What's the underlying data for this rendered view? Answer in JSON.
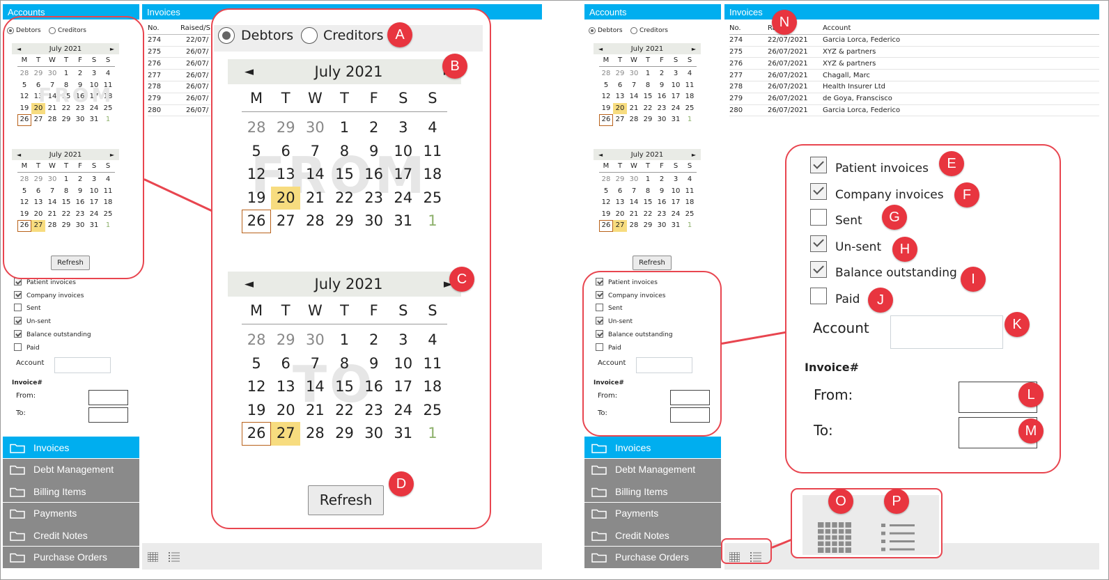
{
  "accounts_title": "Accounts",
  "invoices_title": "Invoices",
  "radio": {
    "debtors": "Debtors",
    "creditors": "Creditors"
  },
  "calendar": {
    "month": "July 2021",
    "prev": "◄",
    "next": "►",
    "dow": [
      "M",
      "T",
      "W",
      "T",
      "F",
      "S",
      "S"
    ],
    "weeks": [
      [
        "28",
        "29",
        "30",
        "1",
        "2",
        "3",
        "4"
      ],
      [
        "5",
        "6",
        "7",
        "8",
        "9",
        "10",
        "11"
      ],
      [
        "12",
        "13",
        "14",
        "15",
        "16",
        "17",
        "18"
      ],
      [
        "19",
        "20",
        "21",
        "22",
        "23",
        "24",
        "25"
      ],
      [
        "26",
        "27",
        "28",
        "29",
        "30",
        "31",
        "1"
      ]
    ],
    "from_watermark": "FROM",
    "to_watermark": "TO"
  },
  "refresh_label": "Refresh",
  "filters": {
    "patient": "Patient invoices",
    "company": "Company invoices",
    "sent": "Sent",
    "unsent": "Un-sent",
    "balance": "Balance outstanding",
    "paid": "Paid",
    "checked": {
      "patient": true,
      "company": true,
      "sent": false,
      "unsent": true,
      "balance": true,
      "paid": false
    },
    "account_label": "Account",
    "account_value": "",
    "invoice_heading": "Invoice#",
    "from_label": "From:",
    "to_label": "To:",
    "from_value": "",
    "to_value": ""
  },
  "table": {
    "columns": [
      "No.",
      "Raised/Sent",
      "Account"
    ],
    "left_raised_header": "Raised/S",
    "right_raised_header": "Ra      ent",
    "rows": [
      {
        "no": "274",
        "raised": "22/07/2021",
        "account": "Garcia Lorca, Federico"
      },
      {
        "no": "275",
        "raised": "26/07/2021",
        "account": "XYZ & partners"
      },
      {
        "no": "276",
        "raised": "26/07/2021",
        "account": "XYZ & partners"
      },
      {
        "no": "277",
        "raised": "26/07/2021",
        "account": "Chagall, Marc"
      },
      {
        "no": "278",
        "raised": "26/07/2021",
        "account": "Health Insurer Ltd"
      },
      {
        "no": "279",
        "raised": "26/07/2021",
        "account": "de Goya, Franscisco"
      },
      {
        "no": "280",
        "raised": "26/07/2021",
        "account": "Garcia Lorca, Federico"
      }
    ],
    "left_raised_truncated": [
      "22/07/",
      "26/07/",
      "26/07/",
      "26/07/",
      "26/07/",
      "26/07/",
      "26/07/"
    ]
  },
  "nav": [
    "Invoices",
    "Debt Management",
    "Billing Items",
    "Payments",
    "Credit Notes",
    "Purchase Orders"
  ],
  "badges": {
    "A": "A",
    "B": "B",
    "C": "C",
    "D": "D",
    "E": "E",
    "F": "F",
    "G": "G",
    "H": "H",
    "I": "I",
    "J": "J",
    "K": "K",
    "L": "L",
    "M": "M",
    "N": "N",
    "O": "O",
    "P": "P"
  },
  "icons": {
    "grid": "grid-view-icon",
    "list": "list-view-icon",
    "folder": "folder-icon"
  },
  "colors": {
    "accent": "#00aeef",
    "callout": "#e8454f",
    "highlight": "#f7dc7f",
    "today": "#b8611a",
    "nav_grey": "#8a8a8a"
  }
}
